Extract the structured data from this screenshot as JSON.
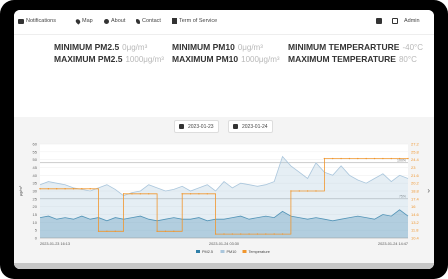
{
  "nav": {
    "items": [
      {
        "label": "Notifications",
        "icon": "envelope-icon"
      },
      {
        "label": "Map",
        "icon": "map-pin-icon"
      },
      {
        "label": "About",
        "icon": "info-icon"
      },
      {
        "label": "Contact",
        "icon": "phone-icon"
      },
      {
        "label": "Term of Service",
        "icon": "document-icon"
      }
    ],
    "right_label": "Admin"
  },
  "stats": {
    "min_pm25": {
      "label": "MINIMUM PM2.5",
      "value": "0μg/m³"
    },
    "max_pm25": {
      "label": "MAXIMUM PM2.5",
      "value": "1000μg/m³"
    },
    "min_pm10": {
      "label": "MINIMUM PM10",
      "value": "0μg/m³"
    },
    "max_pm10": {
      "label": "MAXIMUM PM10",
      "value": "1000μg/m³"
    },
    "min_temp": {
      "label": "MINIMUM TEMPERARTURE",
      "value": "-40°C"
    },
    "max_temp": {
      "label": "MAXIMUM TEMPERATURE",
      "value": "80°C"
    }
  },
  "date_range": {
    "start": "2023-01-23",
    "end": "2023-01-24"
  },
  "chart_data": {
    "type": "line",
    "ylabel": "μg/m³",
    "left_ticks": [
      "60",
      "55",
      "50",
      "45",
      "40",
      "35",
      "30",
      "25",
      "20",
      "15",
      "10",
      "5",
      "0"
    ],
    "right_ticks": [
      "27.2",
      "25.8",
      "24.4",
      "23",
      "21.6",
      "20.2",
      "18.8",
      "17.4",
      "16",
      "14.6",
      "13.2",
      "11.8",
      "10.4"
    ],
    "ylim": [
      0,
      60
    ],
    "y2lim": [
      10.4,
      27.2
    ],
    "x_labels": [
      "2023-01-23 16:13",
      "2023-01-24 03:30",
      "2023-01-24 14:47"
    ],
    "reference_lines": [
      {
        "value": 48,
        "label": "100%"
      },
      {
        "value": 25,
        "label": "75%"
      }
    ],
    "series": [
      {
        "name": "PM2.5",
        "color": "#2f7fa8",
        "axis": "left",
        "values": [
          13,
          14,
          12,
          13,
          12,
          14,
          12,
          13,
          11,
          13,
          12,
          13,
          14,
          12,
          11,
          12,
          13,
          12,
          12,
          13,
          11,
          12,
          12,
          13,
          14,
          12,
          13,
          14,
          13,
          17,
          14,
          13,
          12,
          13,
          12,
          11,
          12,
          13,
          14,
          13,
          12,
          15,
          14,
          18,
          14
        ]
      },
      {
        "name": "PM10",
        "color": "#aac6dc",
        "axis": "left",
        "values": [
          34,
          36,
          35,
          34,
          32,
          31,
          30,
          32,
          34,
          31,
          27,
          29,
          30,
          34,
          32,
          30,
          31,
          33,
          30,
          32,
          34,
          30,
          36,
          32,
          35,
          34,
          33,
          34,
          36,
          52,
          46,
          42,
          38,
          48,
          42,
          40,
          46,
          40,
          37,
          35,
          38,
          41,
          36,
          40,
          38
        ]
      },
      {
        "name": "Temperature",
        "color": "#f0962e",
        "axis": "right",
        "values": [
          19.2,
          19.2,
          19.2,
          19.2,
          19.2,
          19.2,
          19.2,
          11.6,
          11.6,
          11.6,
          18.3,
          18.3,
          18.3,
          18.3,
          11.6,
          11.6,
          11.6,
          18.3,
          18.3,
          18.3,
          18.3,
          11.1,
          11.1,
          11.1,
          11.1,
          11.1,
          11.1,
          11.1,
          11.1,
          11.1,
          18.8,
          18.8,
          18.8,
          18.8,
          24.6,
          24.6,
          24.6,
          24.6,
          24.6,
          24.6,
          24.6,
          24.6,
          24.6,
          24.6,
          24.6
        ]
      }
    ]
  }
}
